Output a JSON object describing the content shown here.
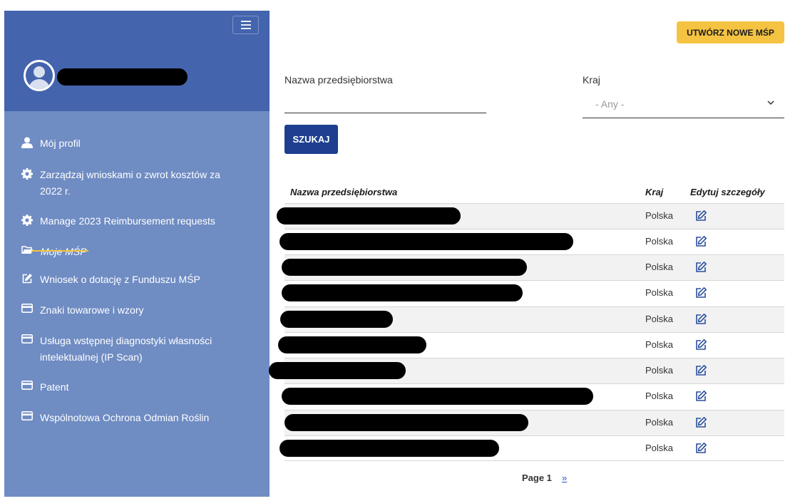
{
  "sidebar": {
    "items": [
      {
        "label": "Mój profil",
        "icon": "user-icon"
      },
      {
        "label": "Zarządzaj wnioskami o zwrot kosztów za 2022 r.",
        "icon": "gear-icon"
      },
      {
        "label": "Manage 2023 Reimbursement requests",
        "icon": "gear-icon"
      },
      {
        "label": "Moje MŚP",
        "icon": "folder-open-icon",
        "active": true
      },
      {
        "label": "Wniosek o dotację z Funduszu MŚP",
        "icon": "edit-icon"
      },
      {
        "label": "Znaki towarowe i wzory",
        "icon": "credit-card-icon"
      },
      {
        "label": "Usługa wstępnej diagnostyki własności intelektualnej (IP Scan)",
        "icon": "credit-card-icon"
      },
      {
        "label": "Patent",
        "icon": "credit-card-icon"
      },
      {
        "label": "Wspólnotowa Ochrona Odmian Roślin",
        "icon": "credit-card-icon"
      }
    ]
  },
  "main": {
    "create_button": "UTWÓRZ NOWE MŚP",
    "filters": {
      "name_label": "Nazwa przedsiębiorstwa",
      "name_value": "",
      "country_label": "Kraj",
      "country_value": "- Any -"
    },
    "search_button": "SZUKAJ",
    "table": {
      "headers": [
        "Nazwa przedsiębiorstwa",
        "Kraj",
        "Edytuj szczegóły"
      ],
      "rows": [
        {
          "country": "Polska"
        },
        {
          "country": "Polska"
        },
        {
          "country": "Polska"
        },
        {
          "country": "Polska"
        },
        {
          "country": "Polska"
        },
        {
          "country": "Polska"
        },
        {
          "country": "Polska"
        },
        {
          "country": "Polska"
        },
        {
          "country": "Polska"
        },
        {
          "country": "Polska"
        }
      ]
    },
    "pager": {
      "current": "Page 1",
      "next": "»"
    }
  },
  "colors": {
    "sidebar_header": "#4464ad",
    "sidebar_body": "#6f8cc3",
    "accent_yellow": "#f5c342",
    "primary_blue": "#1e3f8f",
    "link_blue": "#2b58b6"
  }
}
